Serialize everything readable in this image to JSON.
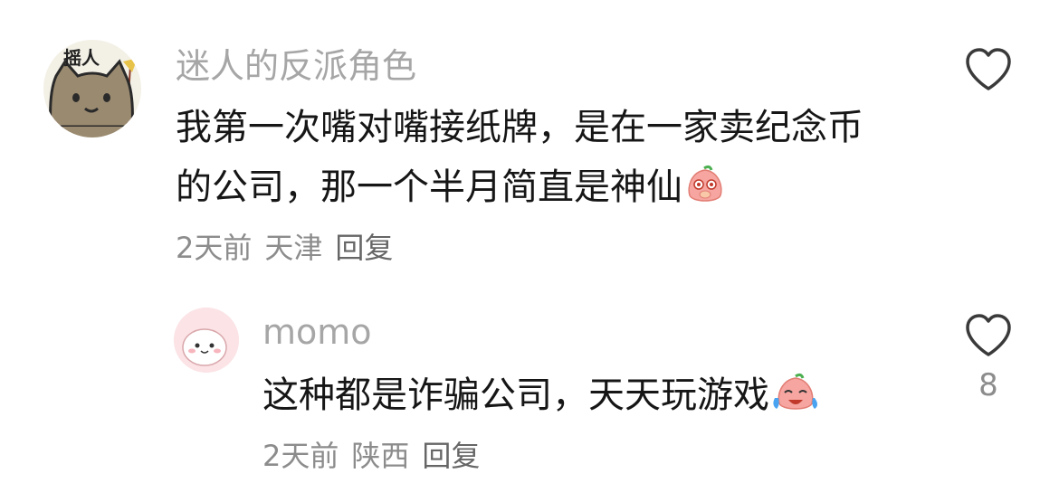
{
  "comment": {
    "avatar_label": "摇人",
    "username": "迷人的反派角色",
    "line1": "我第一次嘴对嘴接纸牌，是在一家卖纪念币",
    "line2": "的公司，那一个半月简直是神仙",
    "emoji": "shy-peach-emoji",
    "time": "2天前",
    "location": "天津",
    "reply_label": "回复",
    "like_icon": "heart-outline-icon"
  },
  "reply": {
    "username": "momo",
    "text": "这种都是诈骗公司，天天玩游戏",
    "emoji": "crying-peach-emoji",
    "time": "2天前",
    "location": "陕西",
    "reply_label": "回复",
    "like_icon": "heart-outline-icon",
    "like_count": "8"
  }
}
